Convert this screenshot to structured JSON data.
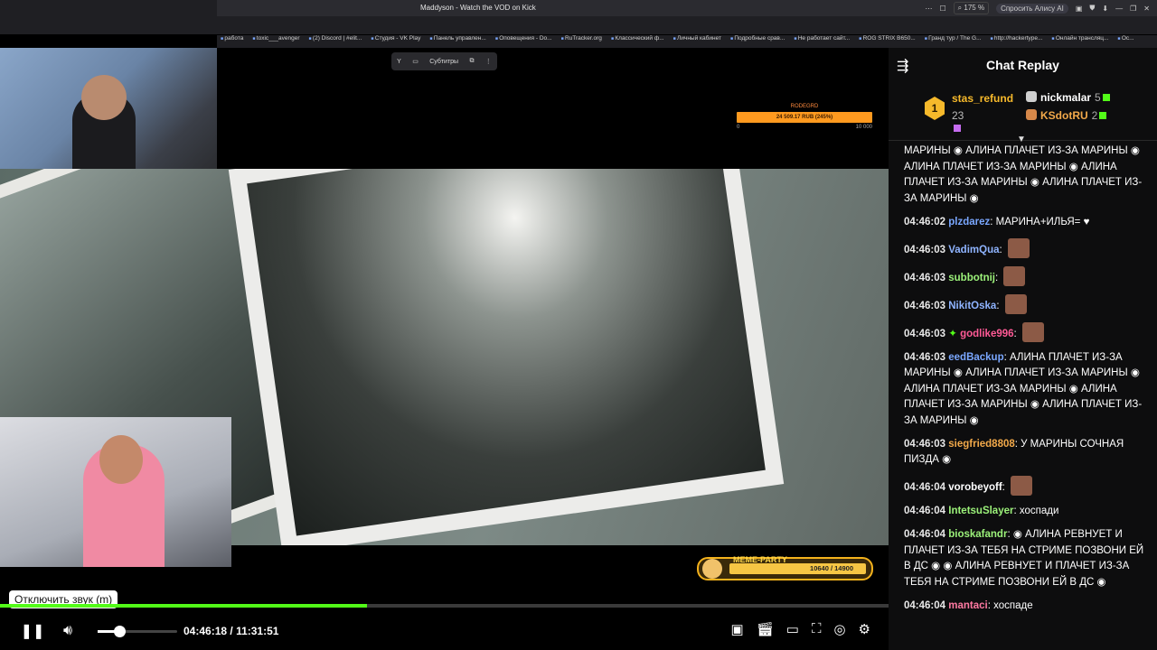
{
  "browser": {
    "tab_title": "Maddyson - Watch the VOD on Kick",
    "zoom": "175 %",
    "alice": "Спросить Алису AI",
    "bookmarks": [
      "работа",
      "toxic___avenger",
      "(2) Discord | #elit...",
      "Студия - VK Play",
      "Панель управлен...",
      "Оповещения - Do...",
      "RuTracker.org",
      "Классический ф...",
      "Личный кабинет",
      "Подробные срав...",
      "Не работает сайт...",
      "ROG STRIX B650...",
      "Гранд тур / The G...",
      "http://hackertype...",
      "Онлайн трансляц...",
      "Ос..."
    ]
  },
  "player": {
    "subtitles_label": "Субтитры",
    "donation": {
      "name": "RODEGRD",
      "amount": "24 509.17 RUB (245%)",
      "start": "0",
      "end": "10 000"
    },
    "meme_party": {
      "label": "MEME-PARTY",
      "progress": "10640 / 14900",
      "fraction": 0.714
    },
    "tooltip": "Отключить звук (m)",
    "progress_fraction": 0.413,
    "volume_fraction": 0.27,
    "time_current": "04:46:18",
    "time_separator": "/",
    "time_total": "11:31:51"
  },
  "chat": {
    "title": "Chat Replay",
    "leaders": [
      {
        "rank": "1",
        "name": "stas_refund",
        "count": "23"
      },
      {
        "rank": "2",
        "name": "nickmalar",
        "count": "5"
      },
      {
        "rank": "3",
        "name": "KSdotRU",
        "count": "2"
      }
    ],
    "colors": {
      "accent": "#53fc18",
      "gold": "#f6b92b"
    },
    "messages": [
      {
        "ts": "",
        "user": "",
        "color": "#ffffff",
        "text": "МАРИНЫ ◉ АЛИНА ПЛАЧЕТ ИЗ-ЗА МАРИНЫ ◉ АЛИНА ПЛАЧЕТ ИЗ-ЗА МАРИНЫ ◉ АЛИНА ПЛАЧЕТ ИЗ-ЗА МАРИНЫ ◉ АЛИНА ПЛАЧЕТ ИЗ-ЗА МАРИНЫ ◉",
        "emotes": 0,
        "faces": 0
      },
      {
        "ts": "04:46:02",
        "user": "plzdarez",
        "color": "#7aa7ff",
        "text": "МАРИНА+ИЛЬЯ= ♥",
        "emotes": 0,
        "faces": 0
      },
      {
        "ts": "04:46:03",
        "user": "VadimQua",
        "color": "#8fb4ff",
        "text": "",
        "emotes": 0,
        "faces": 1
      },
      {
        "ts": "04:46:03",
        "user": "subbotnij",
        "color": "#9cf27a",
        "text": "",
        "emotes": 0,
        "faces": 1
      },
      {
        "ts": "04:46:03",
        "user": "NikitOska",
        "color": "#8fb4ff",
        "text": "",
        "emotes": 0,
        "faces": 1
      },
      {
        "ts": "04:46:03",
        "user": "godlike996",
        "color": "#ff5a96",
        "text": "",
        "emotes": 0,
        "faces": 1
      },
      {
        "ts": "04:46:03",
        "user": "eedBackup",
        "color": "#7aa7ff",
        "text": "АЛИНА ПЛАЧЕТ ИЗ-ЗА МАРИНЫ ◉ АЛИНА ПЛАЧЕТ ИЗ-ЗА МАРИНЫ ◉ АЛИНА ПЛАЧЕТ ИЗ-ЗА МАРИНЫ ◉ АЛИНА ПЛАЧЕТ ИЗ-ЗА МАРИНЫ ◉ АЛИНА ПЛАЧЕТ ИЗ-ЗА МАРИНЫ ◉",
        "emotes": 0,
        "faces": 0
      },
      {
        "ts": "04:46:03",
        "user": "siegfried8808",
        "color": "#f2a94a",
        "text": "У МАРИНЫ СОЧНАЯ ПИЗДА ◉",
        "emotes": 0,
        "faces": 0
      },
      {
        "ts": "04:46:04",
        "user": "vorobeyoff",
        "color": "#ffffff",
        "text": "",
        "emotes": 0,
        "faces": 1
      },
      {
        "ts": "04:46:04",
        "user": "IntetsuSlayer",
        "color": "#9cf27a",
        "text": "хоспади",
        "emotes": 0,
        "faces": 0
      },
      {
        "ts": "04:46:04",
        "user": "bioskafandr",
        "color": "#9cf27a",
        "text": "◉ АЛИНА РЕВНУЕТ И ПЛАЧЕТ ИЗ-ЗА ТЕБЯ НА СТРИМЕ ПОЗВОНИ ЕЙ В ДС ◉ ◉ АЛИНА РЕВНУЕТ И ПЛАЧЕТ ИЗ-ЗА ТЕБЯ НА СТРИМЕ ПОЗВОНИ ЕЙ В ДС ◉",
        "emotes": 0,
        "faces": 0
      },
      {
        "ts": "04:46:04",
        "user": "mantaci",
        "color": "#ff7aa2",
        "text": "хоспаде",
        "emotes": 0,
        "faces": 0
      }
    ]
  }
}
